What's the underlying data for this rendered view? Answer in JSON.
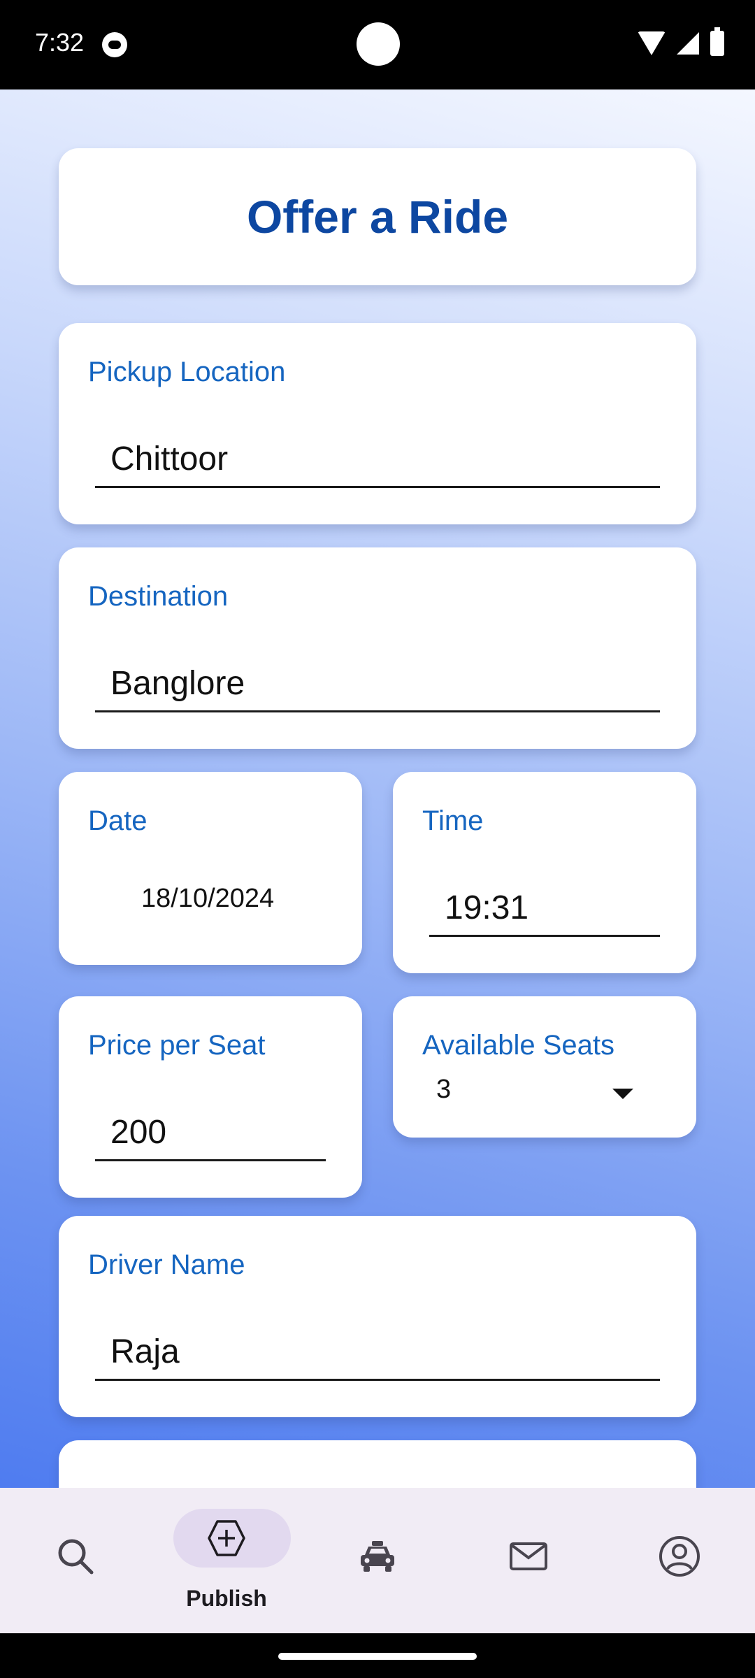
{
  "status_bar": {
    "time": "7:32"
  },
  "page": {
    "title": "Offer a Ride"
  },
  "form": {
    "pickup": {
      "label": "Pickup Location",
      "value": "Chittoor"
    },
    "destination": {
      "label": "Destination",
      "value": "Banglore"
    },
    "date": {
      "label": "Date",
      "value": "18/10/2024"
    },
    "time": {
      "label": "Time",
      "value": "19:31"
    },
    "price": {
      "label": "Price per Seat",
      "value": "200"
    },
    "seats": {
      "label": "Available Seats",
      "value": "3"
    },
    "driver": {
      "label": "Driver Name",
      "value": "Raja"
    }
  },
  "bottom_nav": {
    "items": [
      {
        "icon": "search-icon"
      },
      {
        "icon": "add-icon",
        "label": "Publish",
        "active": true
      },
      {
        "icon": "car-icon"
      },
      {
        "icon": "mail-icon"
      },
      {
        "icon": "account-icon"
      }
    ]
  },
  "colors": {
    "title": "#0d47a1",
    "label": "#1565c0",
    "nav_bg": "#f1ecf5",
    "active_pill": "#e2d9ef"
  }
}
